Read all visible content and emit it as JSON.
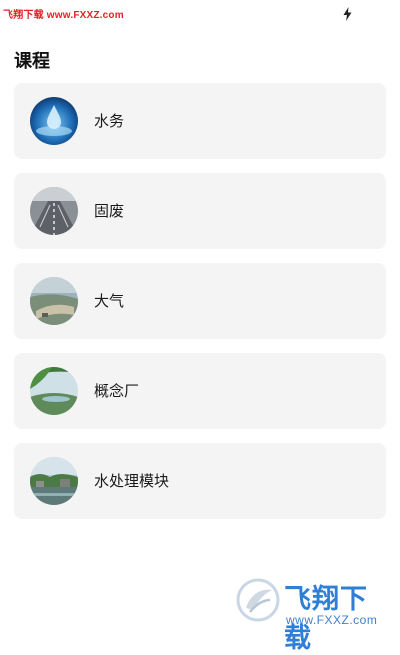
{
  "status_bar": {
    "watermark_text": "飞翔下载 www.FXXZ.com",
    "charging_icon": "lightning-icon"
  },
  "page": {
    "title": "课程"
  },
  "courses": [
    {
      "label": "水务",
      "icon": "water-drop-thumbnail"
    },
    {
      "label": "固废",
      "icon": "road-thumbnail"
    },
    {
      "label": "大气",
      "icon": "aerial-landscape-thumbnail"
    },
    {
      "label": "概念厂",
      "icon": "plant-landscape-thumbnail"
    },
    {
      "label": "水处理模块",
      "icon": "facility-thumbnail"
    }
  ],
  "watermark": {
    "brand": "飞翔下载",
    "url": "www.FXXZ.com"
  },
  "colors": {
    "card_background": "#f4f4f4",
    "watermark_red": "#e0232a",
    "watermark_blue": "#2f7fd6"
  }
}
